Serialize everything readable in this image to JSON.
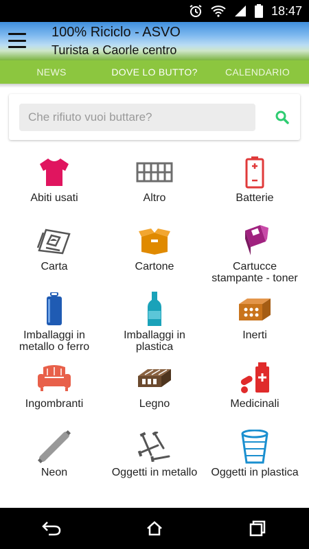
{
  "status_bar": {
    "time": "18:47",
    "icons": [
      "alarm-icon",
      "wifi-icon",
      "signal-icon",
      "battery-icon"
    ]
  },
  "app_bar": {
    "title": "100% Riciclo - ASVO",
    "subtitle": "Turista a Caorle centro",
    "menu_icon": "hamburger-icon"
  },
  "tabs": [
    {
      "label": "NEWS",
      "active": false
    },
    {
      "label": "DOVE LO BUTTO?",
      "active": true
    },
    {
      "label": "CALENDARIO",
      "active": false
    }
  ],
  "search": {
    "placeholder": "Che rifiuto vuoi buttare?",
    "value": "",
    "icon": "search-icon",
    "icon_color": "#2ecc71"
  },
  "categories": [
    {
      "label": "Abiti usati",
      "icon": "tshirt-icon",
      "color": "#e0155f"
    },
    {
      "label": "Altro",
      "icon": "fence-icon",
      "color": "#6d6d6d"
    },
    {
      "label": "Batterie",
      "icon": "battery-icon",
      "color": "#e03a3a"
    },
    {
      "label": "Carta",
      "icon": "newspaper-icon",
      "color": "#555555"
    },
    {
      "label": "Cartone",
      "icon": "box-icon",
      "color": "#e08a00"
    },
    {
      "label": "Cartucce stampante - toner",
      "icon": "cartridge-icon",
      "color": "#a0227f"
    },
    {
      "label": "Imballaggi in metallo o ferro",
      "icon": "can-icon",
      "color": "#1f5bb3"
    },
    {
      "label": "Imballaggi in plastica",
      "icon": "bottle-icon",
      "color": "#1aa2b9"
    },
    {
      "label": "Inerti",
      "icon": "brick-icon",
      "color": "#c9741c"
    },
    {
      "label": "Ingombranti",
      "icon": "armchair-icon",
      "color": "#e8604a"
    },
    {
      "label": "Legno",
      "icon": "pallet-icon",
      "color": "#6b4a2e"
    },
    {
      "label": "Medicinali",
      "icon": "medicine-icon",
      "color": "#e02b2b"
    },
    {
      "label": "Neon",
      "icon": "neon-tube-icon",
      "color": "#999999"
    },
    {
      "label": "Oggetti in metallo",
      "icon": "nails-icon",
      "color": "#555555"
    },
    {
      "label": "Oggetti in plastica",
      "icon": "plastic-cup-icon",
      "color": "#1a8fcf"
    }
  ],
  "nav_bar": {
    "back_icon": "back-icon",
    "home_icon": "home-icon",
    "recents_icon": "recents-icon"
  }
}
